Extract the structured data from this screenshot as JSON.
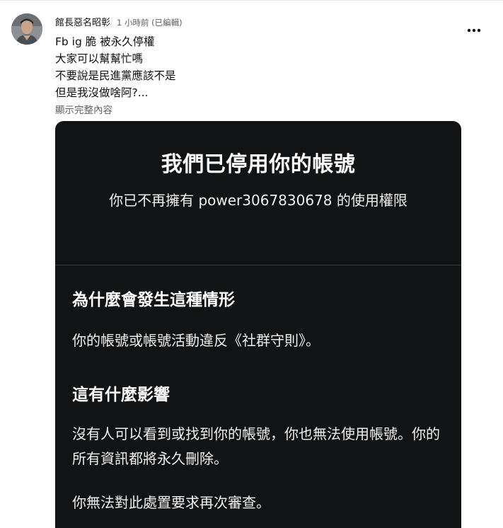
{
  "post": {
    "username": "館長惡名昭彰",
    "timestamp": "1 小時前 (已編輯)",
    "lines": [
      "Fb ig 脆 被永久停權",
      "大家可以幫幫忙嗎",
      "不要說是民進黨應該不是",
      "但是我沒做啥阿?..."
    ],
    "show_more": "顯示完整內容"
  },
  "card": {
    "title": "我們已停用你的帳號",
    "subtitle": "你已不再擁有 power3067830678 的使用權限",
    "section1_heading": "為什麼會發生這種情形",
    "section1_text": "你的帳號或帳號活動違反《社群守則》。",
    "section2_heading": "這有什麼影響",
    "section2_text": "沒有人可以看到或找到你的帳號，你也無法使用帳號。你的所有資訊都將永久刪除。",
    "section3_text": "你無法對此處置要求再次審查。"
  },
  "icons": {
    "more": "more-vertical-icon",
    "avatar": "user-avatar"
  },
  "colors": {
    "card_bg": "#121314",
    "secondary_text": "#606060"
  }
}
